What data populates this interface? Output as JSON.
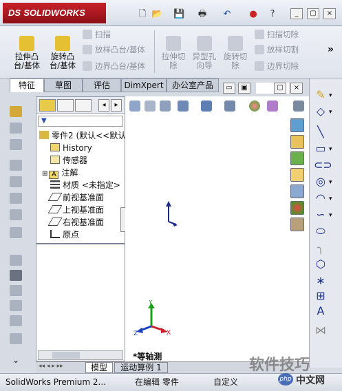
{
  "app": {
    "logo": "SOLIDWORKS",
    "logo_mark": "DS"
  },
  "window_buttons": [
    "_",
    "▢",
    "×"
  ],
  "ribbon": {
    "big": [
      {
        "label1": "拉伸凸",
        "label2": "台/基体"
      },
      {
        "label1": "旋转凸",
        "label2": "台/基体"
      }
    ],
    "small_col1": [
      "扫描",
      "放样凸台/基体",
      "边界凸台/基体"
    ],
    "cut_big": [
      {
        "label1": "拉伸切",
        "label2": "除"
      },
      {
        "label1": "异型孔",
        "label2": "向导"
      },
      {
        "label1": "旋转切",
        "label2": "除"
      }
    ],
    "small_col2": [
      "扫描切除",
      "放样切割",
      "边界切除"
    ],
    "more": "»"
  },
  "tabs": [
    "特征",
    "草图",
    "评估",
    "DimXpert",
    "办公室产品"
  ],
  "tree": {
    "root": "零件2 (默认<<默认",
    "items": [
      "History",
      "传感器",
      "注解",
      "材质 <未指定>",
      "前视基准面",
      "上视基准面",
      "右视基准面",
      "原点"
    ]
  },
  "viewport": {
    "view_label": "*等轴测",
    "axes": {
      "x": "X",
      "y": "Y",
      "z": "Z"
    }
  },
  "bottom_tabs": [
    "模型",
    "运动算例 1"
  ],
  "status": {
    "left": "SolidWorks Premium 2...",
    "mid": "在编辑 零件",
    "right": "自定义"
  },
  "watermark": {
    "text": "软件技巧",
    "sub": "中文网",
    "php": "php"
  }
}
